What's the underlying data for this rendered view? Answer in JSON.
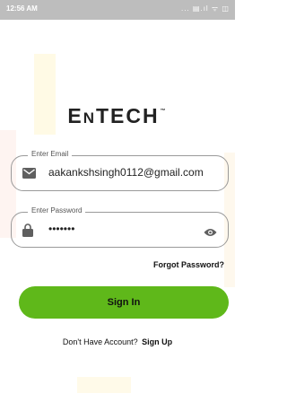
{
  "status_bar": {
    "time": "12:56 AM",
    "icons_text": "... ▤.ıl ᯤ ◫"
  },
  "logo": {
    "first": "E",
    "rest_n": "N",
    "rest_tech": "TECH",
    "tm": "™"
  },
  "email_field": {
    "label": "Enter Email",
    "value": "aakankshsingh0112@gmail.com"
  },
  "password_field": {
    "label": "Enter Password",
    "value": "•••••••"
  },
  "forgot_link": "Forgot Password?",
  "signin_button": "Sign In",
  "signup": {
    "prompt": "Don't Have Account?",
    "link": "Sign Up"
  },
  "colors": {
    "accent": "#5fb81a",
    "status_bar": "#bdbdbd"
  }
}
